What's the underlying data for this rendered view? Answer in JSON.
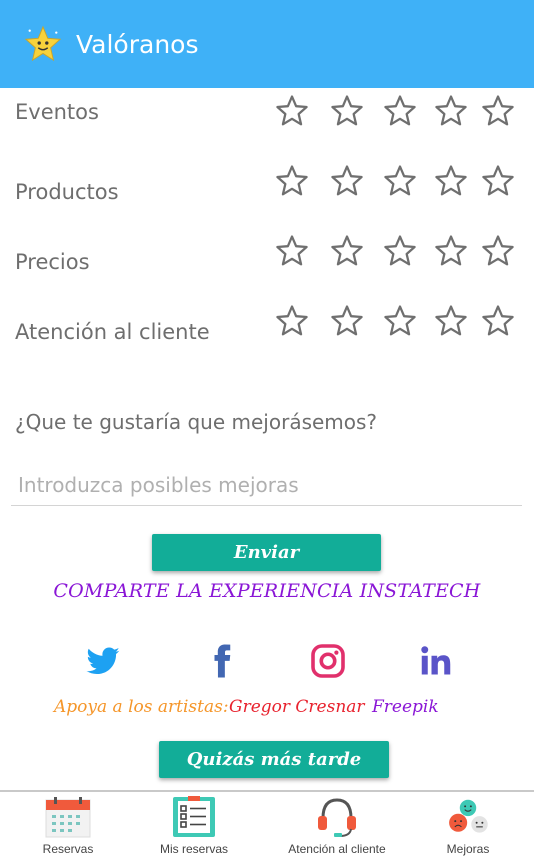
{
  "header": {
    "title": "Valóranos",
    "logo_icon": "star-face-icon",
    "background": "#3fb1f7"
  },
  "ratings": [
    {
      "label": "Eventos",
      "stars": 5,
      "rating": 0
    },
    {
      "label": "Productos",
      "stars": 5,
      "rating": 0
    },
    {
      "label": "Precios",
      "stars": 5,
      "rating": 0
    },
    {
      "label": "Atención al cliente",
      "stars": 5,
      "rating": 0
    }
  ],
  "improvements": {
    "question": "¿Que te gustaría que mejorásemos?",
    "placeholder": "Introduzca posibles mejoras",
    "value": ""
  },
  "send_button": "Enviar",
  "share_text": "COMPARTE LA EXPERIENCIA INSTATECH",
  "social": [
    "twitter-icon",
    "facebook-icon",
    "instagram-icon",
    "linkedin-icon"
  ],
  "artists": {
    "prefix": "Apoya a los artistas:",
    "artist1": "Gregor Cresnar",
    "artist2": "Freepik"
  },
  "later_button": "Quizás más tarde",
  "nav": [
    {
      "label": "Reservas",
      "icon": "calendar-icon"
    },
    {
      "label": "Mis reservas",
      "icon": "checklist-icon"
    },
    {
      "label": "Atención al cliente",
      "icon": "headset-icon"
    },
    {
      "label": "Mejoras",
      "icon": "emoji-faces-icon"
    }
  ],
  "colors": {
    "accent": "#12ad98",
    "share": "#8a16d6",
    "artists_prefix": "#f5962a",
    "artist1": "#e8222e",
    "artist2": "#8a16d6",
    "twitter": "#1da1f2",
    "facebook": "#3b5998",
    "instagram": "#e1306c",
    "linkedin": "#5a54c8"
  }
}
